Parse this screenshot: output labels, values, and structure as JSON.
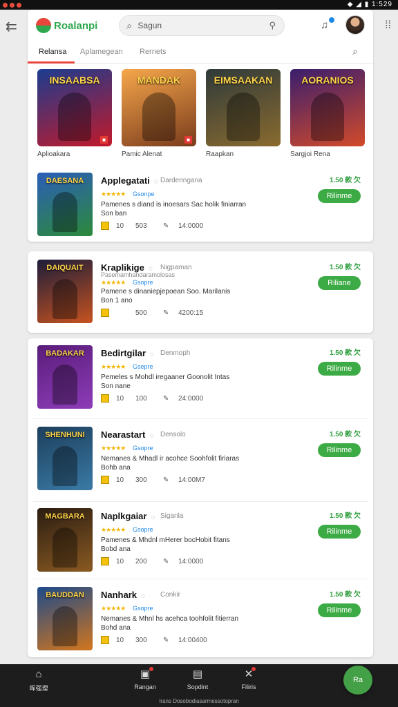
{
  "statusbar": {
    "time": "1:529"
  },
  "header": {
    "logo_text": "Roalanpi",
    "search_placeholder": "Sagun",
    "tabs": [
      "Relansa",
      "Aplamegean",
      "Rernets"
    ]
  },
  "featured": [
    {
      "title": "INSAABSA",
      "caption": "Aplioakara",
      "colors": [
        "#1b3c8f",
        "#c2192a"
      ]
    },
    {
      "title": "MANDAK",
      "caption": "Pamic Alenat",
      "colors": [
        "#f6a74b",
        "#7a3b1c"
      ]
    },
    {
      "title": "EIMSAAKAN",
      "caption": "Raapkan",
      "colors": [
        "#2f3a3a",
        "#8a6b2f"
      ]
    },
    {
      "title": "AORANIOS",
      "caption": "Sargjoi Rena",
      "colors": [
        "#3a1e6e",
        "#d24a2a"
      ]
    }
  ],
  "apps": [
    {
      "name": "Applegatati",
      "publisher": "Dardenngana",
      "stars": "★★★★★",
      "category": "Gsonpe",
      "desc": [
        "Pamenes s diand is inoesars Sac holik finiarran",
        "Son ban"
      ],
      "m1": "10",
      "m2": "503",
      "m3": "14:0000",
      "price": "1.50 款 欠",
      "button": "Rilinme",
      "thumb_title": "DAESANA",
      "colors": [
        "#2b5db8",
        "#2c8a3a"
      ]
    },
    {
      "name": "Kraplikige",
      "publisher": "Nigpaman",
      "category_line": "Pasemamhandaramolosas",
      "stars": "★★★★★",
      "category": "Gsopre",
      "desc": [
        "Pamene s dinaniepjepoean Soo. Marilanis",
        "Bon 1 ano"
      ],
      "m1": "",
      "m2": "500",
      "m3": "4200:15",
      "price": "1.50 款 欠",
      "button": "Riliane",
      "thumb_title": "DAIQUAIT",
      "colors": [
        "#1d1d3a",
        "#c6531f"
      ]
    },
    {
      "name": "Bedirtgilar",
      "publisher": "Denmoph",
      "stars": "★★★★★",
      "category": "Gsepre",
      "desc": [
        "Pemeles s Mohdl iregaaner Goonolit Intas",
        "Son nane"
      ],
      "m1": "10",
      "m2": "100",
      "m3": "24:0000",
      "price": "1.50 款 欠",
      "button": "Rilinme",
      "thumb_title": "BADAKAR",
      "colors": [
        "#5a1d7a",
        "#8d3cb8"
      ]
    },
    {
      "name": "Nearastart",
      "publisher": "Densolo",
      "stars": "★★★★★",
      "category": "Gsopre",
      "desc": [
        "Nemanes & Mhadl ir acohce Soohfolit firiaras",
        "Bohb ana"
      ],
      "m1": "10",
      "m2": "300",
      "m3": "14:00M7",
      "price": "1.50 款 欠",
      "button": "Rilinme",
      "thumb_title": "SHENHUNI",
      "colors": [
        "#1d3f5c",
        "#3a7aa6"
      ]
    },
    {
      "name": "Naplkgaiar",
      "publisher": "Siganla",
      "stars": "★★★★★",
      "category": "Gsopre",
      "desc": [
        "Pamenes & Mhdnl mHerer bocHobit fitans",
        "Bobd ana"
      ],
      "m1": "10",
      "m2": "200",
      "m3": "14:0000",
      "price": "1.50 款 欠",
      "button": "Rilinme",
      "thumb_title": "MAGBARA",
      "colors": [
        "#2b1d12",
        "#8a5a22"
      ]
    },
    {
      "name": "Nanhark",
      "publisher": "Conkir",
      "stars": "★★★★★",
      "category": "Gsopre",
      "desc": [
        "Nemanes & Mhnl hs acehca toohfolit fitierran",
        "Bohd ana"
      ],
      "m1": "10",
      "m2": "300",
      "m3": "14:00400",
      "price": "1.50 款 欠",
      "button": "Rilinme",
      "thumb_title": "BAUDDAN",
      "colors": [
        "#1d4a8a",
        "#d2761d"
      ]
    }
  ],
  "nav": [
    {
      "label": "晖强理",
      "icon": "⌂"
    },
    {
      "label": "Rangan",
      "icon": "▣"
    },
    {
      "label": "Sopdint",
      "icon": "▤"
    },
    {
      "label": "Filiris",
      "icon": "✕"
    }
  ],
  "fab_label": "Ra",
  "footer_text": "Irans Dosobodiasarmessotopran"
}
